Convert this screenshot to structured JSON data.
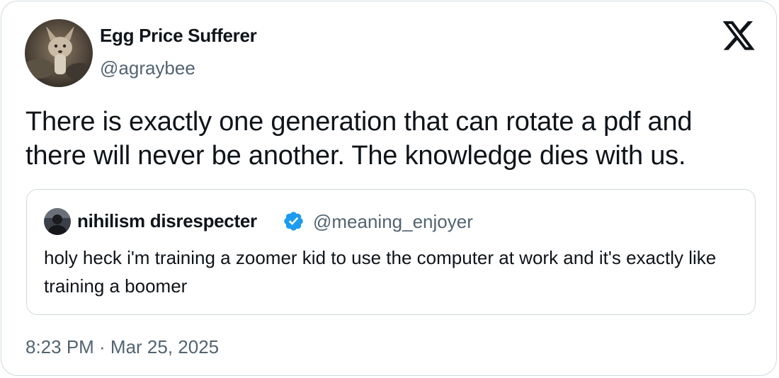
{
  "tweet": {
    "author": {
      "name": "Egg Price Sufferer",
      "handle": "@agraybee",
      "avatar_icon": "avatar-photo"
    },
    "text": "There is exactly one generation that can rotate a pdf and there will never be another. The knowledge dies with us.",
    "timestamp": "8:23 PM · Mar 25, 2025",
    "platform_icon": "x-logo-icon"
  },
  "quoted": {
    "author": {
      "name": "nihilism disrespecter",
      "handle": "@meaning_enjoyer",
      "verified": true,
      "verified_color": "#1d9bf0"
    },
    "text": "holy heck i'm training a zoomer kid to use the computer at work and it's exactly like training a boomer"
  },
  "colors": {
    "text": "#0f1419",
    "secondary": "#536471",
    "border": "#cfd9de"
  }
}
